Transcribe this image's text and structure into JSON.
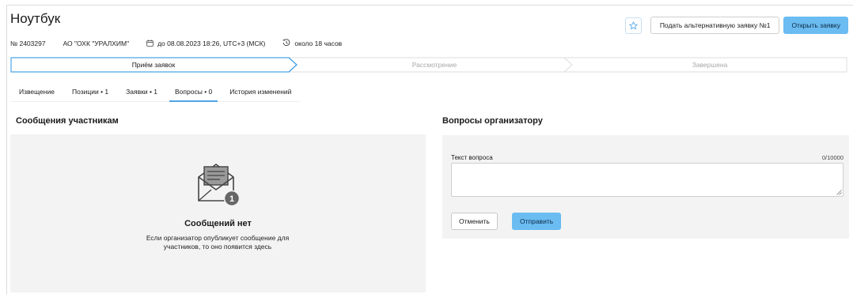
{
  "header": {
    "title": "Ноутбук",
    "number": "№ 2403297",
    "organization": "АО \"ОХК \"УРАЛХИМ\"",
    "deadline": "до 08.08.2023 18:26, UTC+3 (МСК)",
    "time_left": "около 18 часов"
  },
  "actions": {
    "favorite_icon": "star-icon",
    "alternative_label": "Подать альтернативную заявку №1",
    "open_label": "Открыть заявку"
  },
  "stages": [
    {
      "label": "Приём заявок",
      "active": true
    },
    {
      "label": "Рассмотрение",
      "active": false
    },
    {
      "label": "Завершена",
      "active": false
    }
  ],
  "tabs": [
    {
      "label": "Извещение",
      "active": false
    },
    {
      "label": "Позиции • 1",
      "active": false
    },
    {
      "label": "Заявки • 1",
      "active": false
    },
    {
      "label": "Вопросы • 0",
      "active": true
    },
    {
      "label": "История изменений",
      "active": false
    }
  ],
  "messages": {
    "title": "Сообщения участникам",
    "badge": "1",
    "empty_title": "Сообщений нет",
    "empty_text": "Если организатор опубликует сообщение для участников, то оно появится здесь"
  },
  "questions": {
    "title": "Вопросы организатору",
    "field_label": "Текст вопроса",
    "counter": "0/10000",
    "value": "",
    "cancel_label": "Отменить",
    "send_label": "Отправить"
  },
  "colors": {
    "accent": "#6bbcf1",
    "active_border": "#4ea4e6",
    "panel_bg": "#f3f3f3"
  }
}
